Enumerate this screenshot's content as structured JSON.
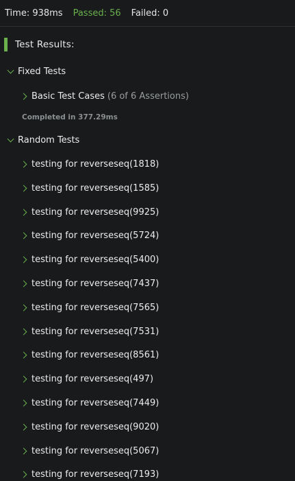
{
  "status": {
    "time": "Time: 938ms",
    "passed": "Passed: 56",
    "failed": "Failed: 0"
  },
  "results": {
    "title": "Test Results:"
  },
  "fixed": {
    "label": "Fixed Tests",
    "basic": {
      "label": "Basic Test Cases",
      "assertions": "(6 of 6 Assertions)"
    },
    "completed": "Completed in 377.29ms"
  },
  "random": {
    "label": "Random Tests",
    "items": [
      "testing for reverseseq(1818)",
      "testing for reverseseq(1585)",
      "testing for reverseseq(9925)",
      "testing for reverseseq(5724)",
      "testing for reverseseq(5400)",
      "testing for reverseseq(7437)",
      "testing for reverseseq(7565)",
      "testing for reverseseq(7531)",
      "testing for reverseseq(8561)",
      "testing for reverseseq(497)",
      "testing for reverseseq(7449)",
      "testing for reverseseq(9020)",
      "testing for reverseseq(5067)",
      "testing for reverseseq(7193)"
    ]
  },
  "colors": {
    "background": "#181a1b",
    "accent_green": "#6ab04c",
    "muted_text": "#9a9d9f"
  },
  "icons": {
    "expanded": "chevron-down-icon",
    "collapsed": "chevron-right-icon"
  }
}
